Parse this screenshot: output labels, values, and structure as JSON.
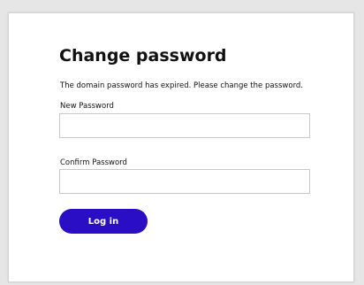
{
  "form": {
    "title": "Change password",
    "message": "The domain password has expired. Please change the password.",
    "new_password": {
      "label": "New Password",
      "value": "",
      "placeholder": ""
    },
    "confirm_password": {
      "label": "Confirm Password",
      "value": "",
      "placeholder": ""
    },
    "submit_label": "Log in"
  },
  "colors": {
    "accent": "#2a0ec6",
    "background": "#e6e6e6",
    "panel": "#ffffff"
  }
}
